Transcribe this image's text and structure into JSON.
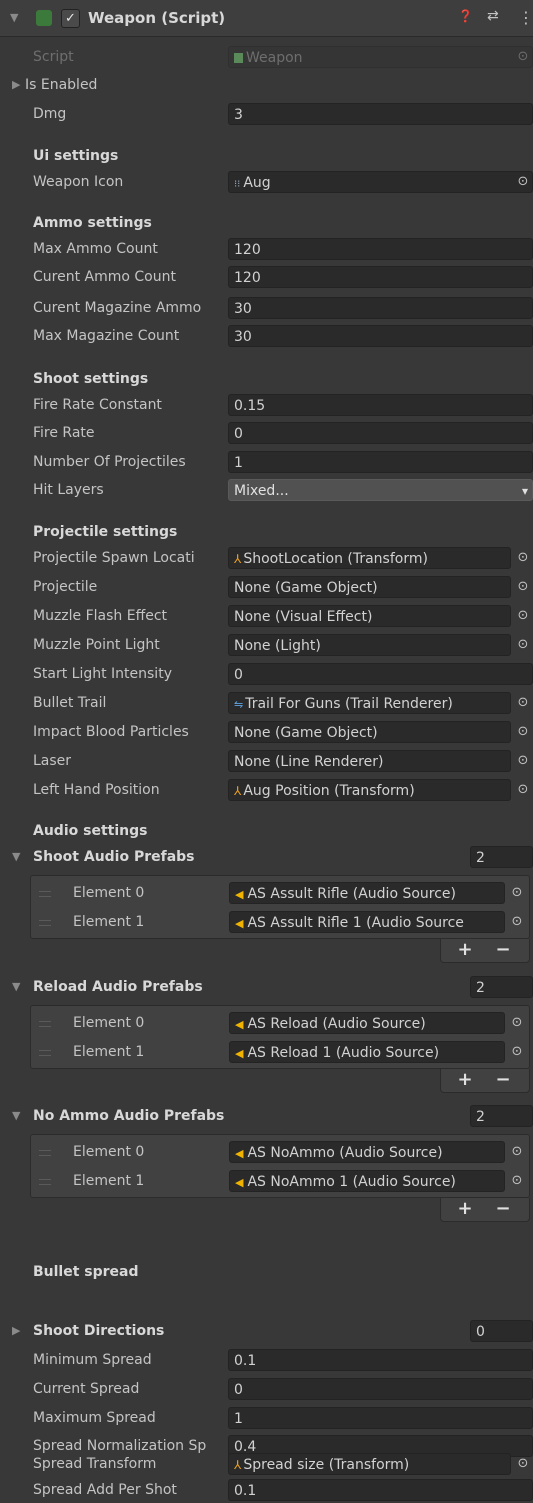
{
  "header": {
    "title": "Weapon (Script)",
    "enabled_check": "✓",
    "help_icon": "❓",
    "preset_icon": "⇄",
    "menu_icon": "⋮"
  },
  "script_row": {
    "label": "Script",
    "value": "Weapon"
  },
  "is_enabled": {
    "label": "Is Enabled"
  },
  "dmg": {
    "label": "Dmg",
    "value": "3"
  },
  "ui_settings": {
    "heading": "Ui settings",
    "weapon_icon_label": "Weapon Icon",
    "weapon_icon_value": "Aug"
  },
  "ammo_settings": {
    "heading": "Ammo settings",
    "fields": [
      {
        "label": "Max Ammo Count",
        "value": "120"
      },
      {
        "label": "Curent Ammo Count",
        "value": "120"
      },
      {
        "label": "Curent Magazine Ammo",
        "value": "30"
      },
      {
        "label": "Max Magazine Count",
        "value": "30"
      }
    ]
  },
  "shoot_settings": {
    "heading": "Shoot settings",
    "fields": [
      {
        "label": "Fire Rate Constant",
        "value": "0.15"
      },
      {
        "label": "Fire Rate",
        "value": "0"
      },
      {
        "label": "Number Of Projectiles",
        "value": "1"
      }
    ],
    "hit_layers_label": "Hit Layers",
    "hit_layers_value": "Mixed..."
  },
  "projectile_settings": {
    "heading": "Projectile settings",
    "fields": [
      {
        "label": "Projectile Spawn Locati",
        "value": "ShootLocation (Transform)"
      },
      {
        "label": "Projectile",
        "value": "None (Game Object)"
      },
      {
        "label": "Muzzle Flash Effect",
        "value": "None (Visual Effect)"
      },
      {
        "label": "Muzzle Point Light",
        "value": "None (Light)"
      }
    ],
    "start_light_label": "Start Light Intensity",
    "start_light_value": "0",
    "fields2": [
      {
        "label": "Bullet Trail",
        "value": "Trail For Guns (Trail Renderer)"
      },
      {
        "label": "Impact Blood Particles",
        "value": "None (Game Object)"
      },
      {
        "label": "Laser",
        "value": "None (Line Renderer)"
      },
      {
        "label": "Left Hand Position",
        "value": "Aug Position (Transform)"
      }
    ]
  },
  "audio_settings": {
    "heading": "Audio settings",
    "lists": [
      {
        "label": "Shoot Audio Prefabs",
        "count": "2",
        "elements": [
          {
            "label": "Element 0",
            "value": "AS Assult Rifle (Audio Source)"
          },
          {
            "label": "Element 1",
            "value": "AS Assult Rifle 1 (Audio Source"
          }
        ]
      },
      {
        "label": "Reload Audio Prefabs",
        "count": "2",
        "elements": [
          {
            "label": "Element 0",
            "value": "AS Reload (Audio Source)"
          },
          {
            "label": "Element 1",
            "value": "AS Reload 1 (Audio Source)"
          }
        ]
      },
      {
        "label": "No Ammo Audio Prefabs",
        "count": "2",
        "elements": [
          {
            "label": "Element 0",
            "value": "AS NoAmmo (Audio Source)"
          },
          {
            "label": "Element 1",
            "value": "AS NoAmmo 1 (Audio Source)"
          }
        ]
      }
    ],
    "add_label": "+",
    "remove_label": "−"
  },
  "bullet_spread": {
    "heading": "Bullet spread",
    "shoot_directions_label": "Shoot Directions",
    "shoot_directions_count": "0",
    "fields": [
      {
        "label": "Minimum Spread",
        "value": "0.1"
      },
      {
        "label": "Current Spread",
        "value": "0"
      },
      {
        "label": "Maximum Spread",
        "value": "1"
      },
      {
        "label": "Spread Normalization Sp",
        "value": "0.4"
      }
    ],
    "spread_transform_label": "Spread Transform",
    "spread_transform_value": "Spread size (Transform)",
    "add_per_shot_label": "Spread Add Per Shot",
    "add_per_shot_value": "0.1"
  },
  "icons": {
    "picker": "⊙",
    "transform": "⅄",
    "audio": "◀",
    "sprite": "⁝⁝",
    "trail": "⇋",
    "foldout_open": "▼",
    "foldout_closed": "▶",
    "dropdown": "▾"
  },
  "colors": {
    "background": "#383838",
    "field": "#2a2a2a",
    "accent_audio": "#f0b400",
    "accent_transform": "#e8a020"
  }
}
